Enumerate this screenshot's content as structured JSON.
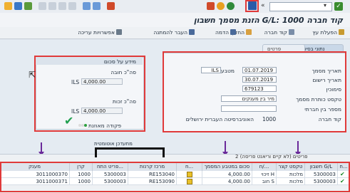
{
  "title": "הזנת מסמך חשבון G/L: קוד חברה 1000",
  "toolbar": {
    "command_value": ""
  },
  "actions": [
    "הפעלת עץ",
    "קוד חברה",
    "החזק",
    "הדמה",
    "העבר להמתנה",
    "אפשרויות עריכה"
  ],
  "tabs": [
    "נתוני בסיס",
    "פרטים"
  ],
  "right_panel": {
    "doc_date_label": "תאריך מסמך",
    "doc_date": "01.07.2019",
    "currency_label": "מטבע",
    "currency": "ILS",
    "post_date_label": "תאריך רישום",
    "post_date": "30.07.2019",
    "reference_label": "סימוכין",
    "reference": "679123",
    "header_text_label": "טקסט כותרת מסמך",
    "header_text": "מיר בין מענקים",
    "cross_cc_label": "מספר בין חברתי",
    "cross_cc": "",
    "company_label": "קוד חברה",
    "company_code": "1000",
    "company_name": "האוניברסיטה העברית ירושלים"
  },
  "left_panel": {
    "group_title": "מידע על סכום",
    "debit_label": "סה\"כ חובה",
    "debit_value": "4,000.00",
    "debit_cur": "ILS",
    "credit_label": "סה\"כ זכות",
    "credit_value": "4,000.00",
    "credit_cur": "ILS",
    "balanced_label": "פקודה מאוזנת"
  },
  "table_label": "מתעדכן אוטומטית",
  "status_line": "2 פריטים (לא קיים וריאנט פריסה)",
  "table": {
    "headers": [
      "ח...",
      "חשבון G/L",
      "טקסט קצר",
      "ח/...",
      "סכום במטבע המסמך",
      "n...",
      "מרכז קרנות",
      "פריט התח...",
      "קרן",
      "מענק"
    ],
    "rows": [
      [
        "",
        "5300003",
        "מלכות",
        "H זיכוי",
        "4,000.00",
        "",
        "RE153040",
        "5300003",
        "1000",
        "3011000370"
      ],
      [
        "",
        "5300003",
        "מלכות",
        "S חוב",
        "4,000.00",
        "",
        "RE153090",
        "5300003",
        "1000",
        "3011000371"
      ]
    ]
  },
  "colors": {
    "annotation_red": "#e03a3a",
    "annotation_purple": "#6a2a9a",
    "check_green": "#20a050"
  }
}
